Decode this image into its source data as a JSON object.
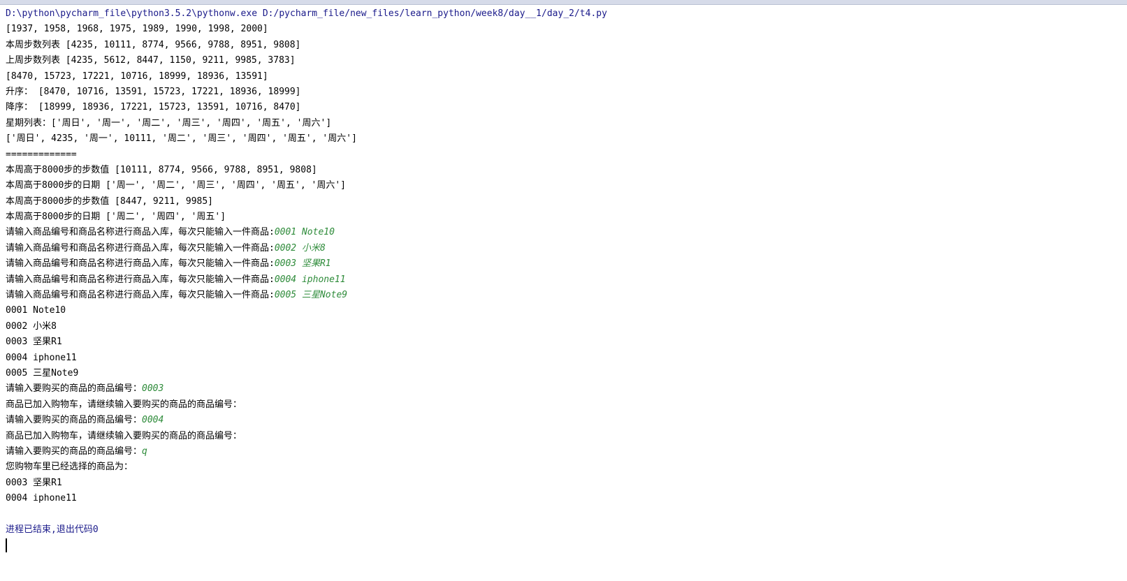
{
  "console": {
    "command": "D:\\python\\pycharm_file\\python3.5.2\\pythonw.exe D:/pycharm_file/new_files/learn_python/week8/day__1/day_2/t4.py",
    "lines": [
      "[1937, 1958, 1968, 1975, 1989, 1990, 1998, 2000]",
      "本周步数列表 [4235, 10111, 8774, 9566, 9788, 8951, 9808]",
      "上周步数列表 [4235, 5612, 8447, 1150, 9211, 9985, 3783]",
      "[8470, 15723, 17221, 10716, 18999, 18936, 13591]",
      "升序： [8470, 10716, 13591, 15723, 17221, 18936, 18999]",
      "降序： [18999, 18936, 17221, 15723, 13591, 10716, 8470]",
      "星期列表：['周日', '周一', '周二', '周三', '周四', '周五', '周六']",
      "['周日', 4235, '周一', 10111, '周二', '周三', '周四', '周五', '周六']",
      "=============",
      "本周高于8000步的步数值 [10111, 8774, 9566, 9788, 8951, 9808]",
      "本周高于8000步的日期 ['周一', '周二', '周三', '周四', '周五', '周六']",
      "本周高于8000步的步数值 [8447, 9211, 9985]",
      "本周高于8000步的日期 ['周二', '周四', '周五']"
    ],
    "stock_prompt": "请输入商品编号和商品名称进行商品入库，每次只能输入一件商品:",
    "stock_inputs": [
      "0001 Note10",
      "0002 小米8",
      "0003 坚果R1",
      "0004 iphone11",
      "0005 三星Note9"
    ],
    "catalog": [
      "0001 Note10",
      "0002 小米8",
      "0003 坚果R1",
      "0004 iphone11",
      "0005 三星Note9"
    ],
    "buy_prompt": "请输入要购买的商品的商品编号：",
    "added_msg": "商品已加入购物车，请继续输入要购买的商品的商品编号：",
    "buy_inputs": [
      "0003",
      "0004",
      "q"
    ],
    "cart_title": "您购物车里已经选择的商品为：",
    "cart_items": [
      "0003 坚果R1",
      "0004 iphone11"
    ],
    "exit_message": "进程已结束,退出代码0"
  },
  "colors": {
    "command": "#1a1a8a",
    "user_input": "#2e8b3a",
    "output": "#000000"
  }
}
